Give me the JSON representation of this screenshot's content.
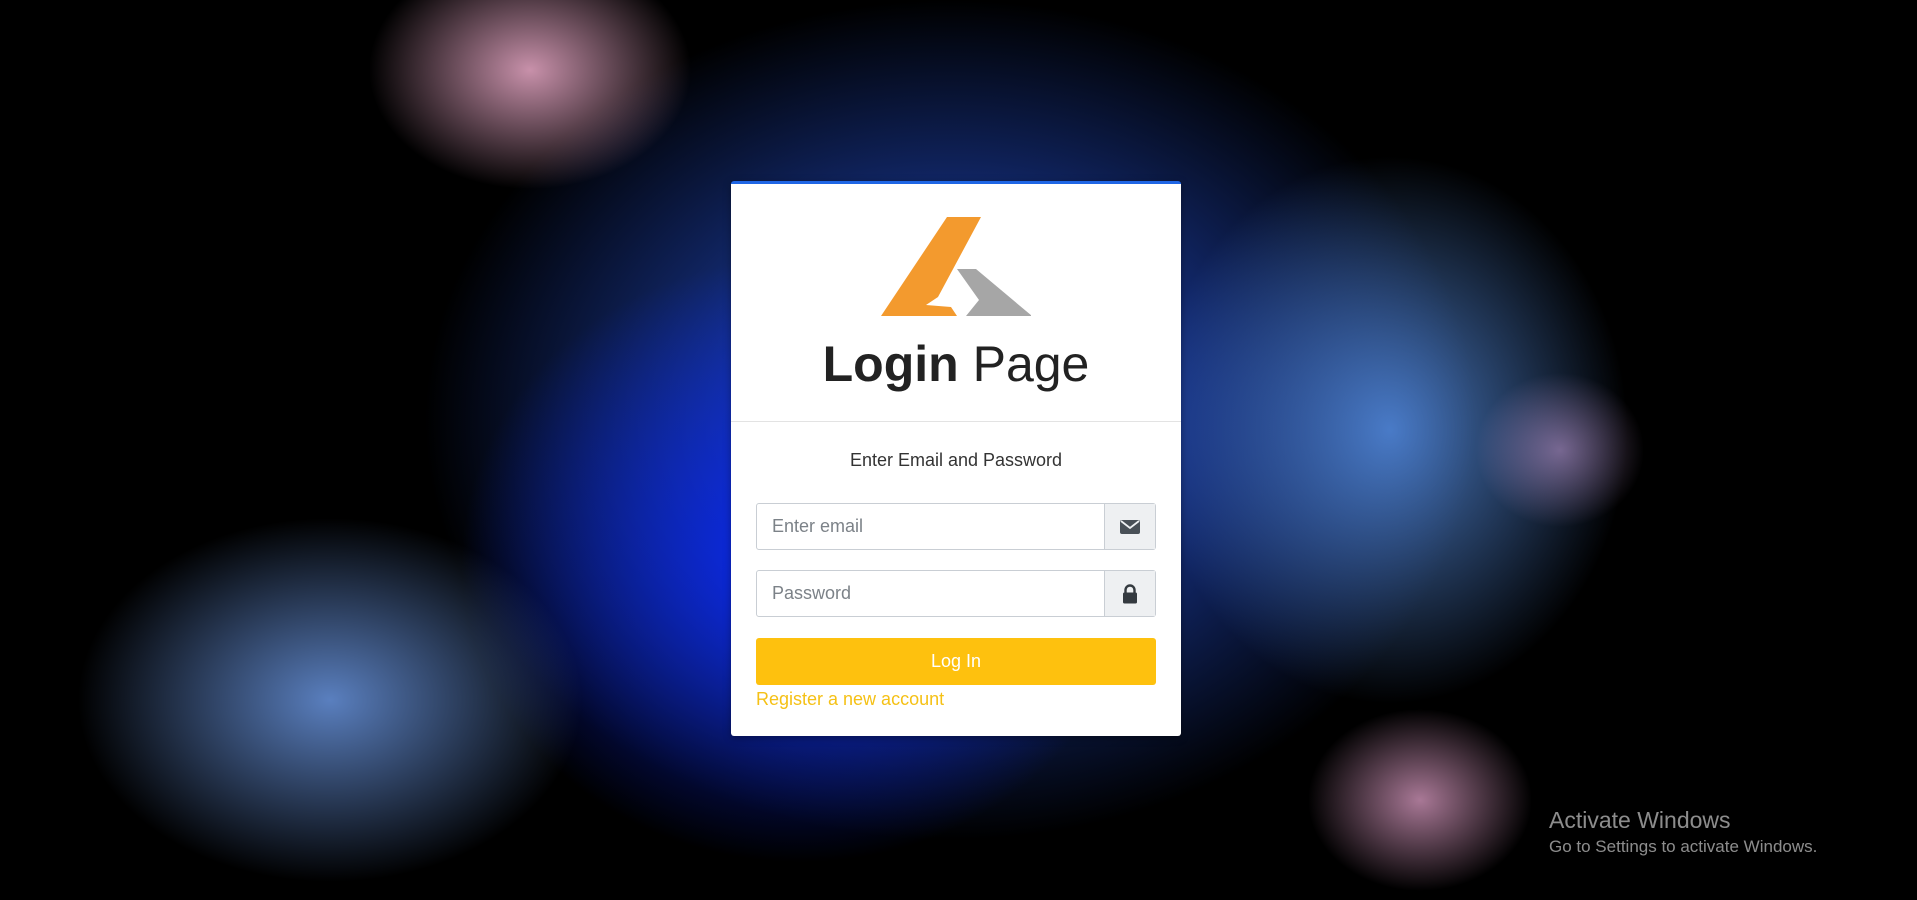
{
  "login": {
    "title_bold": "Login",
    "title_light": "Page",
    "subtitle": "Enter Email and Password",
    "email_placeholder": "Enter email",
    "password_placeholder": "Password",
    "login_button": "Log In",
    "register_link": "Register a new account"
  },
  "icons": {
    "email": "envelope-icon",
    "password": "lock-icon"
  },
  "watermark": {
    "title": "Activate Windows",
    "subtitle": "Go to Settings to activate Windows."
  },
  "colors": {
    "accent": "#fec10e",
    "link": "#f5c116",
    "logo_orange": "#f39a2e",
    "logo_gray": "#a6a6a6",
    "card_border": "#1f66e5"
  }
}
